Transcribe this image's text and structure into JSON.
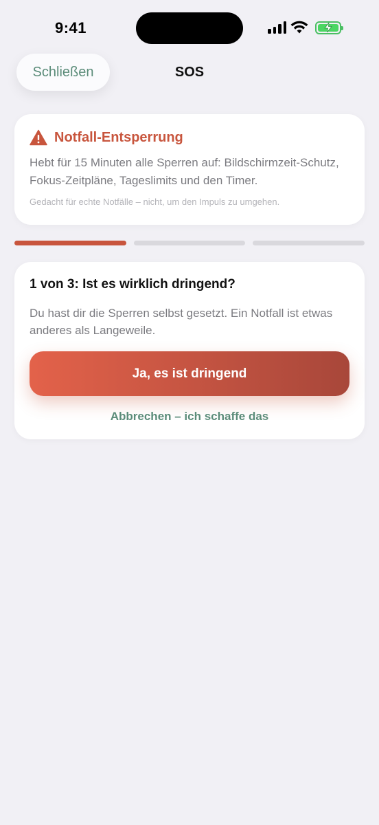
{
  "status_bar": {
    "time": "9:41"
  },
  "nav": {
    "close_label": "Schließen",
    "title": "SOS"
  },
  "info_card": {
    "icon": "warning-triangle-icon",
    "title": "Notfall-Entsperrung",
    "description": "Hebt für 15 Minuten alle Sperren auf: Bildschirmzeit-Schutz, Fokus-Zeitpläne, Tageslimits und den Timer.",
    "note": "Gedacht für echte Notfälle – nicht, um den Impuls zu umgehen."
  },
  "progress": {
    "current_step": 1,
    "total_steps": 3
  },
  "step": {
    "title": "1 von 3: Ist es wirklich dringend?",
    "description": "Du hast dir die Sperren selbst gesetzt. Ein Notfall ist etwas anderes als Langeweile.",
    "confirm_label": "Ja, es ist dringend",
    "cancel_label": "Abbrechen – ich schaffe das"
  },
  "colors": {
    "accent": "#c8553d",
    "secondary": "#5b8c79",
    "background": "#f1f0f5"
  }
}
